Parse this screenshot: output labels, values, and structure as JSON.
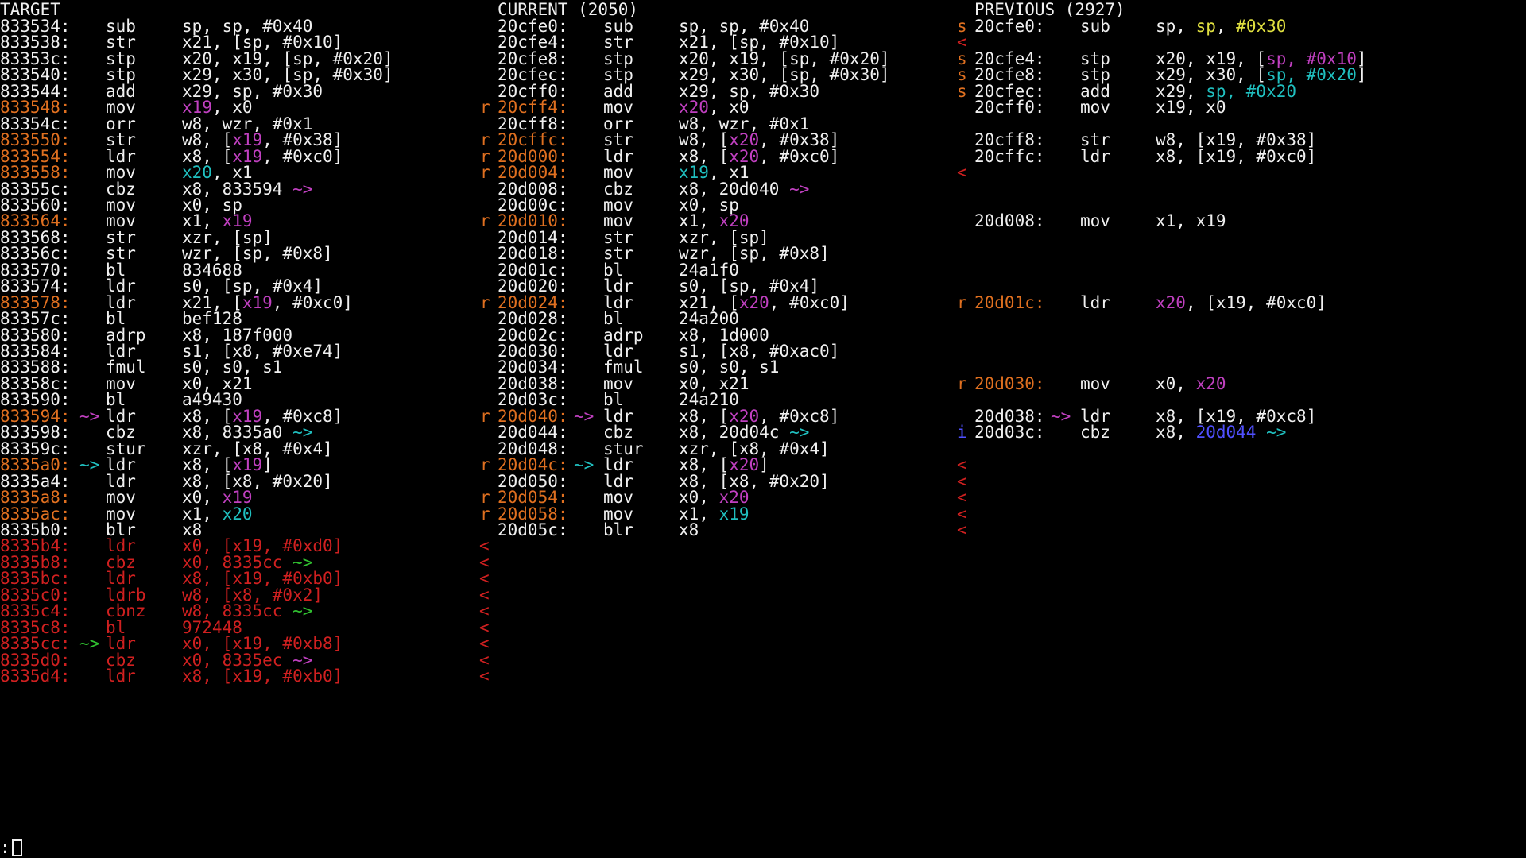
{
  "colors": {
    "default": "#f0f0f0",
    "orange": "#e07020",
    "magenta": "#c040c0",
    "cyan": "#20c0c0",
    "red": "#d02020",
    "green": "#30c030",
    "yellow": "#e0e040",
    "blue": "#5050ff"
  },
  "headers": {
    "target": "TARGET",
    "current": "CURRENT (2050)",
    "previous": "PREVIOUS (2927)"
  },
  "target": [
    {
      "addr": "833534:",
      "op": "sub",
      "args": [
        [
          "sp, sp, #0x40",
          ""
        ]
      ]
    },
    {
      "addr": "833538:",
      "op": "str",
      "args": [
        [
          "x21, [sp, #0x10]",
          ""
        ]
      ]
    },
    {
      "addr": "83353c:",
      "op": "stp",
      "args": [
        [
          "x20, x19, [sp, #0x20]",
          ""
        ]
      ]
    },
    {
      "addr": "833540:",
      "op": "stp",
      "args": [
        [
          "x29, x30, [sp, #0x30]",
          ""
        ]
      ]
    },
    {
      "addr": "833544:",
      "op": "add",
      "args": [
        [
          "x29, sp, #0x30",
          ""
        ]
      ]
    },
    {
      "addr": "833548:",
      "addr_color": "orange",
      "op": "mov",
      "args": [
        [
          "x19",
          "magenta"
        ],
        [
          ", x0",
          ""
        ]
      ]
    },
    {
      "addr": "83354c:",
      "op": "orr",
      "args": [
        [
          "w8, wzr, #0x1",
          ""
        ]
      ]
    },
    {
      "addr": "833550:",
      "addr_color": "orange",
      "op": "str",
      "args": [
        [
          "w8, [",
          ""
        ],
        [
          "x19",
          "magenta"
        ],
        [
          ", #0x38]",
          ""
        ]
      ]
    },
    {
      "addr": "833554:",
      "addr_color": "orange",
      "op": "ldr",
      "args": [
        [
          "x8, [",
          ""
        ],
        [
          "x19",
          "magenta"
        ],
        [
          ", #0xc0]",
          ""
        ]
      ]
    },
    {
      "addr": "833558:",
      "addr_color": "orange",
      "op": "mov",
      "args": [
        [
          "x20",
          "cyan"
        ],
        [
          ", x1",
          ""
        ]
      ]
    },
    {
      "addr": "83355c:",
      "op": "cbz",
      "args": [
        [
          "x8, 833594 ",
          ""
        ],
        [
          "~>",
          "magenta"
        ]
      ]
    },
    {
      "addr": "833560:",
      "op": "mov",
      "args": [
        [
          "x0, sp",
          ""
        ]
      ]
    },
    {
      "addr": "833564:",
      "addr_color": "orange",
      "op": "mov",
      "args": [
        [
          "x1, ",
          ""
        ],
        [
          "x19",
          "magenta"
        ]
      ]
    },
    {
      "addr": "833568:",
      "op": "str",
      "args": [
        [
          "xzr, [sp]",
          ""
        ]
      ]
    },
    {
      "addr": "83356c:",
      "op": "str",
      "args": [
        [
          "wzr, [sp, #0x8]",
          ""
        ]
      ]
    },
    {
      "addr": "833570:",
      "op": "bl",
      "args": [
        [
          "834688",
          ""
        ]
      ]
    },
    {
      "addr": "833574:",
      "op": "ldr",
      "args": [
        [
          "s0, [sp, #0x4]",
          ""
        ]
      ]
    },
    {
      "addr": "833578:",
      "addr_color": "orange",
      "op": "ldr",
      "args": [
        [
          "x21, [",
          ""
        ],
        [
          "x19",
          "magenta"
        ],
        [
          ", #0xc0]",
          ""
        ]
      ]
    },
    {
      "addr": "83357c:",
      "op": "bl",
      "args": [
        [
          "bef128",
          ""
        ]
      ]
    },
    {
      "addr": "833580:",
      "op": "adrp",
      "args": [
        [
          "x8, 187f000",
          ""
        ]
      ]
    },
    {
      "addr": "833584:",
      "op": "ldr",
      "args": [
        [
          "s1, [x8, #0xe74]",
          ""
        ]
      ]
    },
    {
      "addr": "833588:",
      "op": "fmul",
      "args": [
        [
          "s0, s0, s1",
          ""
        ]
      ]
    },
    {
      "addr": "83358c:",
      "op": "mov",
      "args": [
        [
          "x0, x21",
          ""
        ]
      ]
    },
    {
      "addr": "833590:",
      "op": "bl",
      "args": [
        [
          "a49430",
          ""
        ]
      ]
    },
    {
      "addr": "833594:",
      "addr_color": "orange",
      "arrow": "~>",
      "arrow_color": "magenta",
      "op": "ldr",
      "args": [
        [
          "x8, [",
          ""
        ],
        [
          "x19",
          "magenta"
        ],
        [
          ", #0xc8]",
          ""
        ]
      ]
    },
    {
      "addr": "833598:",
      "op": "cbz",
      "args": [
        [
          "x8, 8335a0 ",
          ""
        ],
        [
          "~>",
          "cyan"
        ]
      ]
    },
    {
      "addr": "83359c:",
      "op": "stur",
      "args": [
        [
          "xzr, [x8, #0x4]",
          ""
        ]
      ]
    },
    {
      "addr": "8335a0:",
      "addr_color": "orange",
      "arrow": "~>",
      "arrow_color": "cyan",
      "op": "ldr",
      "args": [
        [
          "x8, [",
          ""
        ],
        [
          "x19",
          "magenta"
        ],
        [
          "]",
          ""
        ]
      ]
    },
    {
      "addr": "8335a4:",
      "op": "ldr",
      "args": [
        [
          "x8, [x8, #0x20]",
          ""
        ]
      ]
    },
    {
      "addr": "8335a8:",
      "addr_color": "orange",
      "op": "mov",
      "args": [
        [
          "x0, ",
          ""
        ],
        [
          "x19",
          "magenta"
        ]
      ]
    },
    {
      "addr": "8335ac:",
      "addr_color": "orange",
      "op": "mov",
      "args": [
        [
          "x1, ",
          ""
        ],
        [
          "x20",
          "cyan"
        ]
      ]
    },
    {
      "addr": "8335b0:",
      "op": "blr",
      "args": [
        [
          "x8",
          ""
        ]
      ]
    },
    {
      "addr": "8335b4:",
      "addr_color": "red",
      "op": "ldr",
      "op_color": "red",
      "args": [
        [
          "x0, [x19, #0xd0]",
          "red"
        ]
      ],
      "mark": "<"
    },
    {
      "addr": "8335b8:",
      "addr_color": "red",
      "op": "cbz",
      "op_color": "red",
      "args": [
        [
          "x0, 8335cc ",
          "red"
        ],
        [
          "~>",
          "green"
        ]
      ],
      "mark": "<"
    },
    {
      "addr": "8335bc:",
      "addr_color": "red",
      "op": "ldr",
      "op_color": "red",
      "args": [
        [
          "x8, [x19, #0xb0]",
          "red"
        ]
      ],
      "mark": "<"
    },
    {
      "addr": "8335c0:",
      "addr_color": "red",
      "op": "ldrb",
      "op_color": "red",
      "args": [
        [
          "w8, [x8, #0x2]",
          "red"
        ]
      ],
      "mark": "<"
    },
    {
      "addr": "8335c4:",
      "addr_color": "red",
      "op": "cbnz",
      "op_color": "red",
      "args": [
        [
          "w8, 8335cc ",
          "red"
        ],
        [
          "~>",
          "green"
        ]
      ],
      "mark": "<"
    },
    {
      "addr": "8335c8:",
      "addr_color": "red",
      "op": "bl",
      "op_color": "red",
      "args": [
        [
          "972448",
          "red"
        ]
      ],
      "mark": "<"
    },
    {
      "addr": "8335cc:",
      "addr_color": "red",
      "arrow": "~>",
      "arrow_color": "green",
      "op": "ldr",
      "op_color": "red",
      "args": [
        [
          "x0, [x19, #0xb8]",
          "red"
        ]
      ],
      "mark": "<"
    },
    {
      "addr": "8335d0:",
      "addr_color": "red",
      "op": "cbz",
      "op_color": "red",
      "args": [
        [
          "x0, 8335ec ",
          "red"
        ],
        [
          "~>",
          "magenta"
        ]
      ],
      "mark": "<"
    },
    {
      "addr": "8335d4:",
      "addr_color": "red",
      "op": "ldr",
      "op_color": "red",
      "args": [
        [
          "x8, [x19, #0xb0]",
          "red"
        ]
      ],
      "mark": "<"
    }
  ],
  "current": [
    {
      "addr": "20cfe0:",
      "op": "sub",
      "args": [
        [
          "sp, sp, #0x40",
          ""
        ]
      ]
    },
    {
      "addr": "20cfe4:",
      "op": "str",
      "args": [
        [
          "x21, [sp, #0x10]",
          ""
        ]
      ]
    },
    {
      "addr": "20cfe8:",
      "op": "stp",
      "args": [
        [
          "x20, x19, [sp, #0x20]",
          ""
        ]
      ]
    },
    {
      "addr": "20cfec:",
      "op": "stp",
      "args": [
        [
          "x29, x30, [sp, #0x30]",
          ""
        ]
      ]
    },
    {
      "addr": "20cff0:",
      "op": "add",
      "args": [
        [
          "x29, sp, #0x30",
          ""
        ]
      ]
    },
    {
      "mark": "r",
      "addr": "20cff4:",
      "addr_color": "orange",
      "op": "mov",
      "args": [
        [
          "x20",
          "magenta"
        ],
        [
          ", x0",
          ""
        ]
      ]
    },
    {
      "addr": "20cff8:",
      "op": "orr",
      "args": [
        [
          "w8, wzr, #0x1",
          ""
        ]
      ]
    },
    {
      "mark": "r",
      "addr": "20cffc:",
      "addr_color": "orange",
      "op": "str",
      "args": [
        [
          "w8, [",
          ""
        ],
        [
          "x20",
          "magenta"
        ],
        [
          ", #0x38]",
          ""
        ]
      ]
    },
    {
      "mark": "r",
      "addr": "20d000:",
      "addr_color": "orange",
      "op": "ldr",
      "args": [
        [
          "x8, [",
          ""
        ],
        [
          "x20",
          "magenta"
        ],
        [
          ", #0xc0]",
          ""
        ]
      ]
    },
    {
      "mark": "r",
      "addr": "20d004:",
      "addr_color": "orange",
      "op": "mov",
      "args": [
        [
          "x19",
          "cyan"
        ],
        [
          ", x1",
          ""
        ]
      ]
    },
    {
      "addr": "20d008:",
      "op": "cbz",
      "args": [
        [
          "x8, 20d040 ",
          ""
        ],
        [
          "~>",
          "magenta"
        ]
      ]
    },
    {
      "addr": "20d00c:",
      "op": "mov",
      "args": [
        [
          "x0, sp",
          ""
        ]
      ]
    },
    {
      "mark": "r",
      "addr": "20d010:",
      "addr_color": "orange",
      "op": "mov",
      "args": [
        [
          "x1, ",
          ""
        ],
        [
          "x20",
          "magenta"
        ]
      ]
    },
    {
      "addr": "20d014:",
      "op": "str",
      "args": [
        [
          "xzr, [sp]",
          ""
        ]
      ]
    },
    {
      "addr": "20d018:",
      "op": "str",
      "args": [
        [
          "wzr, [sp, #0x8]",
          ""
        ]
      ]
    },
    {
      "addr": "20d01c:",
      "op": "bl",
      "args": [
        [
          "24a1f0",
          ""
        ]
      ]
    },
    {
      "addr": "20d020:",
      "op": "ldr",
      "args": [
        [
          "s0, [sp, #0x4]",
          ""
        ]
      ]
    },
    {
      "mark": "r",
      "addr": "20d024:",
      "addr_color": "orange",
      "op": "ldr",
      "args": [
        [
          "x21, [",
          ""
        ],
        [
          "x20",
          "magenta"
        ],
        [
          ", #0xc0]",
          ""
        ]
      ]
    },
    {
      "addr": "20d028:",
      "op": "bl",
      "args": [
        [
          "24a200",
          ""
        ]
      ]
    },
    {
      "addr": "20d02c:",
      "op": "adrp",
      "args": [
        [
          "x8, 1d000",
          ""
        ]
      ]
    },
    {
      "addr": "20d030:",
      "op": "ldr",
      "args": [
        [
          "s1, [x8, #0xac0]",
          ""
        ]
      ]
    },
    {
      "addr": "20d034:",
      "op": "fmul",
      "args": [
        [
          "s0, s0, s1",
          ""
        ]
      ]
    },
    {
      "addr": "20d038:",
      "op": "mov",
      "args": [
        [
          "x0, x21",
          ""
        ]
      ]
    },
    {
      "addr": "20d03c:",
      "op": "bl",
      "args": [
        [
          "24a210",
          ""
        ]
      ]
    },
    {
      "mark": "r",
      "addr": "20d040:",
      "addr_color": "orange",
      "arrow": "~>",
      "arrow_color": "magenta",
      "op": "ldr",
      "args": [
        [
          "x8, [",
          ""
        ],
        [
          "x20",
          "magenta"
        ],
        [
          ", #0xc8]",
          ""
        ]
      ]
    },
    {
      "addr": "20d044:",
      "op": "cbz",
      "args": [
        [
          "x8, 20d04c ",
          ""
        ],
        [
          "~>",
          "cyan"
        ]
      ]
    },
    {
      "addr": "20d048:",
      "op": "stur",
      "args": [
        [
          "xzr, [x8, #0x4]",
          ""
        ]
      ]
    },
    {
      "mark": "r",
      "addr": "20d04c:",
      "addr_color": "orange",
      "arrow": "~>",
      "arrow_color": "cyan",
      "op": "ldr",
      "args": [
        [
          "x8, [",
          ""
        ],
        [
          "x20",
          "magenta"
        ],
        [
          "]",
          ""
        ]
      ]
    },
    {
      "addr": "20d050:",
      "op": "ldr",
      "args": [
        [
          "x8, [x8, #0x20]",
          ""
        ]
      ]
    },
    {
      "mark": "r",
      "addr": "20d054:",
      "addr_color": "orange",
      "op": "mov",
      "args": [
        [
          "x0, ",
          ""
        ],
        [
          "x20",
          "magenta"
        ]
      ]
    },
    {
      "mark": "r",
      "addr": "20d058:",
      "addr_color": "orange",
      "op": "mov",
      "args": [
        [
          "x1, ",
          ""
        ],
        [
          "x19",
          "cyan"
        ]
      ]
    },
    {
      "addr": "20d05c:",
      "op": "blr",
      "args": [
        [
          "x8",
          ""
        ]
      ]
    }
  ],
  "previous": [
    {
      "row": 0,
      "mark": "s",
      "addr": "20cfe0:",
      "op": "sub",
      "args": [
        [
          "sp, ",
          ""
        ],
        [
          "sp",
          "yellow"
        ],
        [
          ", ",
          ""
        ],
        [
          "#0x30",
          "yellow"
        ]
      ]
    },
    {
      "row": 1,
      "mark": "<",
      "mark_color": "red"
    },
    {
      "row": 2,
      "mark": "s",
      "addr": "20cfe4:",
      "op": "stp",
      "args": [
        [
          "x20, x19, [",
          ""
        ],
        [
          "sp, #0x10",
          "magenta"
        ],
        [
          "]",
          ""
        ]
      ]
    },
    {
      "row": 3,
      "mark": "s",
      "addr": "20cfe8:",
      "op": "stp",
      "args": [
        [
          "x29, x30, [",
          ""
        ],
        [
          "sp, #0x20",
          "cyan"
        ],
        [
          "]",
          ""
        ]
      ]
    },
    {
      "row": 4,
      "mark": "s",
      "addr": "20cfec:",
      "op": "add",
      "args": [
        [
          "x29, ",
          ""
        ],
        [
          "sp, #0x20",
          "cyan"
        ]
      ]
    },
    {
      "row": 5,
      "addr": "20cff0:",
      "op": "mov",
      "args": [
        [
          "x19, x0",
          ""
        ]
      ]
    },
    {
      "row": 7,
      "addr": "20cff8:",
      "op": "str",
      "args": [
        [
          "w8, [x19, #0x38]",
          ""
        ]
      ]
    },
    {
      "row": 8,
      "addr": "20cffc:",
      "op": "ldr",
      "args": [
        [
          "x8, [x19, #0xc0]",
          ""
        ]
      ]
    },
    {
      "row": 9,
      "mark": "<",
      "mark_color": "red"
    },
    {
      "row": 12,
      "addr": "20d008:",
      "op": "mov",
      "args": [
        [
          "x1, x19",
          ""
        ]
      ]
    },
    {
      "row": 17,
      "mark": "r",
      "addr": "20d01c:",
      "addr_color": "orange",
      "op": "ldr",
      "args": [
        [
          "x20",
          "magenta"
        ],
        [
          ", [x19, #0xc0]",
          ""
        ]
      ]
    },
    {
      "row": 22,
      "mark": "r",
      "addr": "20d030:",
      "addr_color": "orange",
      "op": "mov",
      "args": [
        [
          "x0, ",
          ""
        ],
        [
          "x20",
          "magenta"
        ]
      ]
    },
    {
      "row": 24,
      "addr": "20d038:",
      "arrow": "~>",
      "arrow_color": "magenta",
      "op": "ldr",
      "args": [
        [
          "x8, [x19, #0xc8]",
          ""
        ]
      ]
    },
    {
      "row": 25,
      "mark": "i",
      "mark_color": "blue",
      "addr": "20d03c:",
      "op": "cbz",
      "args": [
        [
          "x8, ",
          ""
        ],
        [
          "20d044",
          "blue"
        ],
        [
          " ",
          ""
        ],
        [
          "~>",
          "cyan"
        ]
      ]
    },
    {
      "row": 27,
      "mark": "<",
      "mark_color": "red"
    },
    {
      "row": 28,
      "mark": "<",
      "mark_color": "red"
    },
    {
      "row": 29,
      "mark": "<",
      "mark_color": "red"
    },
    {
      "row": 30,
      "mark": "<",
      "mark_color": "red"
    },
    {
      "row": 31,
      "mark": "<",
      "mark_color": "red"
    }
  ],
  "prompt": ":"
}
